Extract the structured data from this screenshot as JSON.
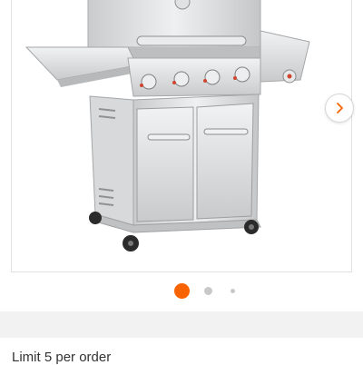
{
  "gallery": {
    "image_subject": "stainless-steel gas grill with side burner",
    "next_icon": "chevron-right-icon",
    "dots": {
      "count": 3,
      "active_index": 0
    },
    "active_dot_color": "#f96302",
    "inactive_dot_color": "#c8c8c8"
  },
  "purchase": {
    "limit_text": "Limit 5 per order"
  }
}
